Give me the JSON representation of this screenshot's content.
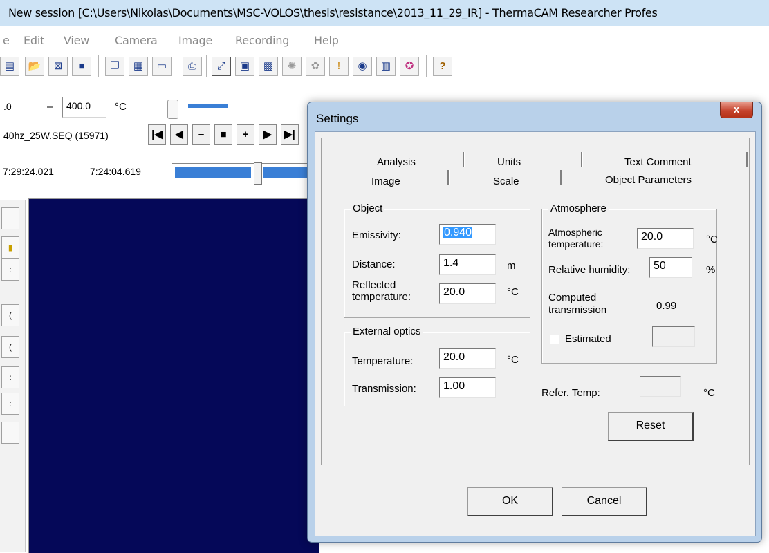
{
  "window": {
    "title": "New session [C:\\Users\\Nikolas\\Documents\\MSC-VOLOS\\thesis\\resistance\\2013_11_29_IR] - ThermaCAM Researcher Profes"
  },
  "menu": [
    "e",
    "Edit",
    "View",
    "Camera",
    "Image",
    "Recording",
    "Help"
  ],
  "toolbar": {
    "icons": [
      "new-icon",
      "open-icon",
      "open-image-icon",
      "save-icon",
      "copy-icon",
      "copy-image-icon",
      "paste-icon",
      "print-icon",
      "fit-icon",
      "camera-icon",
      "image-icon",
      "palette-icon",
      "analysis-icon",
      "marker-icon",
      "record-icon",
      "settings-icon",
      "color-icon",
      "help-icon"
    ]
  },
  "range": {
    "min": ".0",
    "max": "400.0",
    "unit": "°C"
  },
  "sequence": {
    "file": "40hz_25W.SEQ (15971)",
    "buttons": [
      "|◀",
      "◀",
      "–",
      "■",
      "+",
      "▶",
      "▶|"
    ],
    "time_start": "7:29:24.021",
    "time_current": "7:24:04.619"
  },
  "dialog": {
    "title": "Settings",
    "close_label": "x",
    "tabs_row1": [
      "Analysis",
      "Units",
      "Text Comment"
    ],
    "tabs_row2": [
      "Image",
      "Scale",
      "Object Parameters"
    ],
    "object": {
      "title": "Object",
      "emissivity_label": "Emissivity:",
      "emissivity": "0.940",
      "distance_label": "Distance:",
      "distance": "1.4",
      "distance_unit": "m",
      "reflected_label_1": "Reflected",
      "reflected_label_2": "temperature:",
      "reflected": "20.0",
      "reflected_unit": "°C"
    },
    "external_optics": {
      "title": "External optics",
      "temperature_label": "Temperature:",
      "temperature": "20.0",
      "temperature_unit": "°C",
      "transmission_label": "Transmission:",
      "transmission": "1.00"
    },
    "atmosphere": {
      "title": "Atmosphere",
      "temp_label_1": "Atmospheric",
      "temp_label_2": "temperature:",
      "temp": "20.0",
      "temp_unit": "°C",
      "humidity_label": "Relative humidity:",
      "humidity": "50",
      "humidity_unit": "%",
      "computed_label_1": "Computed",
      "computed_label_2": "transmission",
      "computed": "0.99",
      "estimated_label": "Estimated",
      "estimated_value": ""
    },
    "refer_temp_label": "Refer. Temp:",
    "refer_temp": "",
    "refer_temp_unit": "°C",
    "reset_label": "Reset",
    "ok_label": "OK",
    "cancel_label": "Cancel"
  }
}
